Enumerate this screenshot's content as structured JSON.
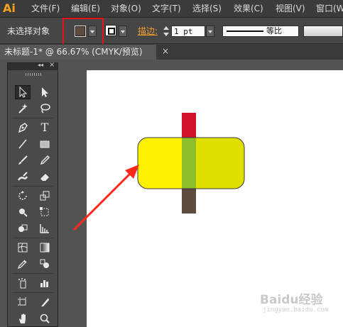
{
  "app": {
    "logo": "Ai"
  },
  "menubar": {
    "items": [
      "文件(F)",
      "编辑(E)",
      "对象(O)",
      "文字(T)",
      "选择(S)",
      "效果(C)",
      "视图(V)",
      "窗口(W)"
    ]
  },
  "controlbar": {
    "selection_label": "未选择对象",
    "stroke_label": "描边:",
    "stroke_weight": "1 pt",
    "profile_label": "等比",
    "fill_color": "#5d4b3f",
    "stroke_color": "#ffffff"
  },
  "tabbar": {
    "document_tab": "未标题-1* @ 66.67% (CMYK/预览)",
    "close": "×"
  },
  "tools_panel": {
    "collapse": "◂◂",
    "close": "×",
    "tools": [
      "selection-tool",
      "direct-selection-tool",
      "magic-wand-tool",
      "lasso-tool",
      "pen-tool",
      "type-tool",
      "line-tool",
      "rectangle-tool",
      "paintbrush-tool",
      "pencil-tool",
      "blob-brush-tool",
      "eraser-tool",
      "rotate-tool",
      "scale-tool",
      "warp-tool",
      "free-transform-tool",
      "shape-builder-tool",
      "perspective-grid-tool",
      "mesh-tool",
      "gradient-tool",
      "eyedropper-tool",
      "blend-tool",
      "symbol-sprayer-tool",
      "column-graph-tool",
      "artboard-tool",
      "slice-tool",
      "hand-tool",
      "zoom-tool"
    ],
    "type_glyph": "T"
  },
  "canvas": {
    "colors": {
      "rounded_rect_left": "#fff200",
      "rounded_rect_right": "#dfe000",
      "overlap": "#8fbe2b",
      "bar_top": "#d0122b",
      "bar_bottom": "#5d4b3f",
      "outline": "#3a3a3a",
      "arrow": "#ff2a1a",
      "highlight": "#e8141c"
    }
  },
  "watermark": {
    "text": "Baidu经验",
    "sub": "jingyan.baidu.com"
  }
}
